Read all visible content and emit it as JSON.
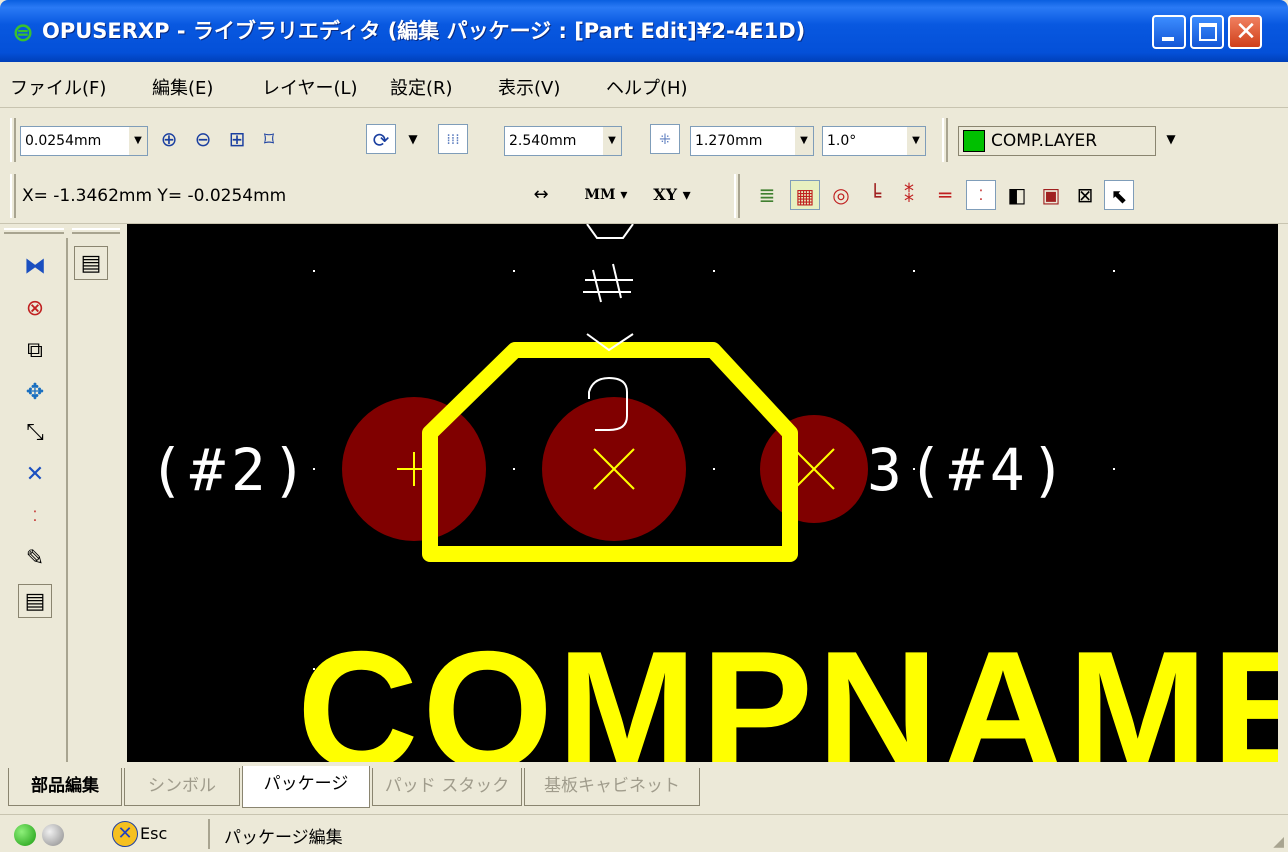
{
  "window": {
    "title": "OPUSERXP - ライブラリエディタ (編集 パッケージ : [Part Edit]¥2-4E1D)"
  },
  "menu": [
    "ファイル(F)",
    "編集(E)",
    "レイヤー(L)",
    "設定(R)",
    "表示(V)",
    "ヘルプ(H)"
  ],
  "toolbar1": {
    "unit_step": "0.0254mm",
    "grid1": "2.540mm",
    "grid2": "1.270mm",
    "angle": "1.0°",
    "layer": "COMP.LAYER",
    "layer_color": "#00c000"
  },
  "toolbar2": {
    "coords": "X= -1.3462mm  Y= -0.0254mm",
    "unit": "MM",
    "coord_mode": "XY"
  },
  "canvas": {
    "pad1_label": "(#2)",
    "pad3_label": "3(#4)",
    "component_name": "COMPNAME",
    "colors": {
      "background": "#000000",
      "outline": "#ffff00",
      "pad": "#800000",
      "text": "#ffffff"
    }
  },
  "tabs": [
    {
      "label": "部品編集",
      "state": "normal"
    },
    {
      "label": "シンボル",
      "state": "disabled"
    },
    {
      "label": "パッケージ",
      "state": "active"
    },
    {
      "label": "パッド スタック",
      "state": "disabled"
    },
    {
      "label": "基板キャビネット",
      "state": "disabled"
    }
  ],
  "status": {
    "esc_label": "Esc",
    "message": "パッケージ編集"
  }
}
